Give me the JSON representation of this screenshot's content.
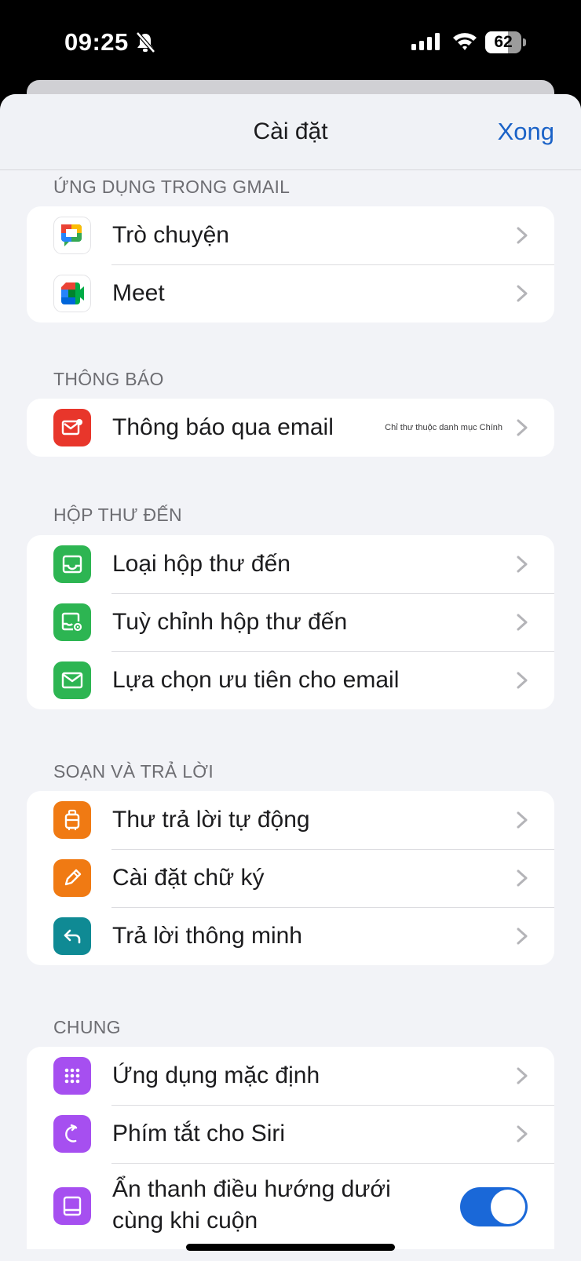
{
  "status_bar": {
    "time": "09:25",
    "battery_level": 62,
    "battery_text": "62"
  },
  "nav": {
    "title": "Cài đặt",
    "done_label": "Xong"
  },
  "sections": {
    "apps": {
      "header": "ỨNG DỤNG TRONG GMAIL",
      "items": [
        {
          "label": "Trò chuyện",
          "icon": "google-chat-icon"
        },
        {
          "label": "Meet",
          "icon": "google-meet-icon"
        }
      ]
    },
    "notifications": {
      "header": "THÔNG BÁO",
      "items": [
        {
          "label": "Thông báo qua email",
          "detail": "Chỉ thư thuộc danh mục Chính",
          "icon": "mail-notification-icon",
          "icon_color": "#e8362b"
        }
      ]
    },
    "inbox": {
      "header": "HỘP THƯ ĐẾN",
      "items": [
        {
          "label": "Loại hộp thư đến",
          "icon": "inbox-tray-icon",
          "icon_color": "#2db552"
        },
        {
          "label": "Tuỳ chỉnh hộp thư đến",
          "icon": "inbox-settings-icon",
          "icon_color": "#2db552"
        },
        {
          "label": "Lựa chọn ưu tiên cho email",
          "icon": "envelope-icon",
          "icon_color": "#2db552"
        }
      ]
    },
    "compose": {
      "header": "SOẠN VÀ TRẢ LỜI",
      "items": [
        {
          "label": "Thư trả lời tự động",
          "icon": "suitcase-icon",
          "icon_color": "#f07a13"
        },
        {
          "label": "Cài đặt chữ ký",
          "icon": "pen-icon",
          "icon_color": "#f07a13"
        },
        {
          "label": "Trả lời thông minh",
          "icon": "reply-arrow-icon",
          "icon_color": "#0f8a94"
        }
      ]
    },
    "general": {
      "header": "CHUNG",
      "items": [
        {
          "label": "Ứng dụng mặc định",
          "icon": "app-grid-icon",
          "icon_color": "#a64ff0"
        },
        {
          "label": "Phím tắt cho Siri",
          "icon": "siri-shortcut-icon",
          "icon_color": "#a64ff0"
        },
        {
          "label": "Ẩn thanh điều hướng dưới cùng khi cuộn",
          "icon": "bottom-bar-icon",
          "icon_color": "#a64ff0",
          "toggle_on": true
        }
      ]
    }
  }
}
